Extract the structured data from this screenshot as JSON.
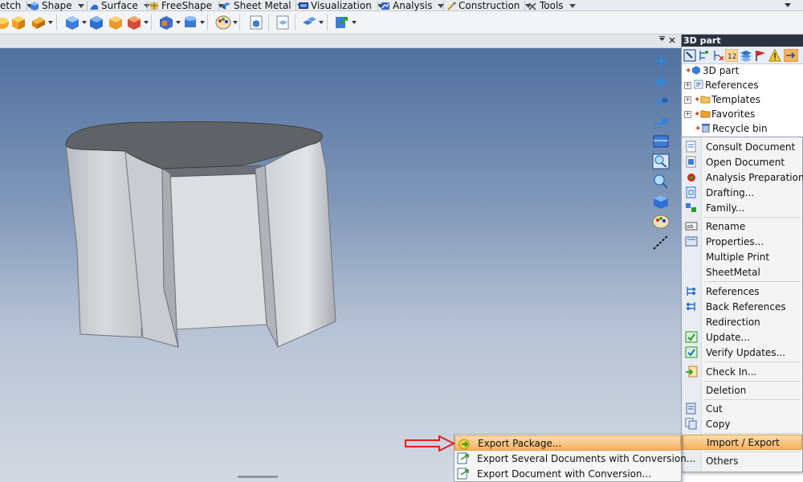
{
  "tabs": [
    {
      "label": "etch",
      "icon": "sketch-icon"
    },
    {
      "label": "Shape",
      "icon": "shape-cube-icon"
    },
    {
      "label": "Surface",
      "icon": "surface-icon"
    },
    {
      "label": "FreeShape",
      "icon": "freeshape-icon"
    },
    {
      "label": "Sheet Metal",
      "icon": "sheet-metal-icon"
    },
    {
      "label": "Visualization",
      "icon": "visualization-icon"
    },
    {
      "label": "Analysis",
      "icon": "analysis-icon"
    },
    {
      "label": "Construction",
      "icon": "construction-icon"
    },
    {
      "label": "Tools",
      "icon": "tools-icon"
    }
  ],
  "panel": {
    "title": "3D part",
    "tree": [
      {
        "label": "3D part",
        "icon": "part-icon",
        "expander": false
      },
      {
        "label": "References",
        "icon": "references-icon",
        "expander": true
      },
      {
        "label": "Templates",
        "icon": "folder-icon",
        "expander": true
      },
      {
        "label": "Favorites",
        "icon": "favorites-folder-icon",
        "expander": true
      },
      {
        "label": "Recycle bin",
        "icon": "recycle-bin-icon",
        "expander": false
      }
    ]
  },
  "context_menu": {
    "items": [
      {
        "label": "Consult Document"
      },
      {
        "label": "Open Document"
      },
      {
        "label": "Analysis Preparation..."
      },
      {
        "label": "Drafting..."
      },
      {
        "label": "Family..."
      },
      {
        "label": "Rename"
      },
      {
        "label": "Properties..."
      },
      {
        "label": "Multiple Print"
      },
      {
        "label": "SheetMetal"
      },
      {
        "label": "References"
      },
      {
        "label": "Back References"
      },
      {
        "label": "Redirection"
      },
      {
        "label": "Update..."
      },
      {
        "label": "Verify Updates..."
      },
      {
        "label": "Check In..."
      },
      {
        "label": "Deletion"
      },
      {
        "label": "Cut"
      },
      {
        "label": "Copy"
      },
      {
        "label": "Import / Export",
        "highlighted": true
      },
      {
        "label": "Others"
      }
    ]
  },
  "submenu": {
    "items": [
      {
        "label": "Export Package...",
        "highlighted": true
      },
      {
        "label": "Export Several Documents with Conversion..."
      },
      {
        "label": "Export Document with Conversion..."
      }
    ]
  },
  "colors": {
    "highlight": "#f6b25d",
    "panel_title_bg": "#2b3240",
    "viewport_top": "#50709f",
    "annotation_arrow": "#e02020"
  }
}
